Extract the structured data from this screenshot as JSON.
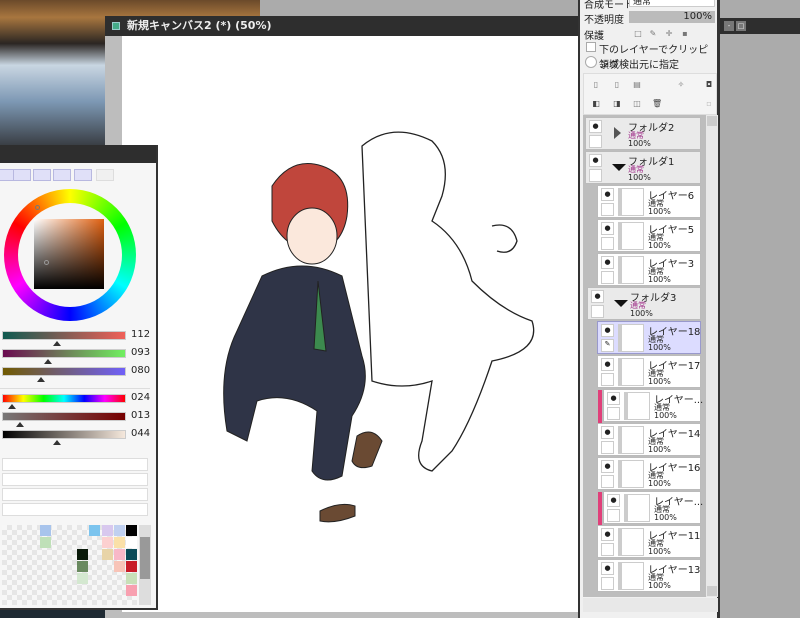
{
  "canvas": {
    "title": "新規キャンバス2 (*) (50%)"
  },
  "color_panel": {
    "sliders_rgb": [
      {
        "value": "112",
        "fraction": 0.44
      },
      {
        "value": "093",
        "fraction": 0.36
      },
      {
        "value": "080",
        "fraction": 0.31
      }
    ],
    "sliders_hsv": [
      {
        "value": "024",
        "fraction": 0.07
      },
      {
        "value": "013",
        "fraction": 0.13
      },
      {
        "value": "044",
        "fraction": 0.44
      }
    ],
    "swatch_colors": [
      "#a8c4ec",
      "#7cc4ee",
      "#d8c8ee",
      "#c0d0f0",
      "#000000",
      "#bfe0b8",
      "#fcd0d0",
      "#fae0a8",
      "#ffffff",
      "#0a1a0a",
      "#e8d4a8",
      "#f8b8c8",
      "#0a4a58",
      "#6a8a60",
      "#f8c4b8",
      "#c81c28",
      "#d4e8d0",
      "#c8e0b8",
      "#f8a0b0"
    ]
  },
  "layer_panel": {
    "blend_mode_label": "合成モード",
    "blend_mode_value": "通常",
    "opacity_label": "不透明度",
    "opacity_value": "100%",
    "protect_label": "保護",
    "clip_label": "下のレイヤーでクリッピング",
    "selection_source_label": "領域検出元に指定",
    "layers": [
      {
        "name": "フォルダ2",
        "mode": "通常",
        "opacity": "100%",
        "type": "folder",
        "expanded": false
      },
      {
        "name": "フォルダ1",
        "mode": "通常",
        "opacity": "100%",
        "type": "folder",
        "expanded": true
      },
      {
        "name": "レイヤー6",
        "mode": "通常",
        "opacity": "100%",
        "type": "layer"
      },
      {
        "name": "レイヤー5",
        "mode": "通常",
        "opacity": "100%",
        "type": "layer"
      },
      {
        "name": "レイヤー3",
        "mode": "通常",
        "opacity": "100%",
        "type": "layer"
      },
      {
        "name": "フォルダ3",
        "mode": "通常",
        "opacity": "100%",
        "type": "folder",
        "expanded": true
      },
      {
        "name": "レイヤー18",
        "mode": "通常",
        "opacity": "100%",
        "type": "layer",
        "selected": true
      },
      {
        "name": "レイヤー17",
        "mode": "通常",
        "opacity": "100%",
        "type": "layer"
      },
      {
        "name": "レイヤー...",
        "mode": "通常",
        "opacity": "100%",
        "type": "layer",
        "clipped": true
      },
      {
        "name": "レイヤー14",
        "mode": "通常",
        "opacity": "100%",
        "type": "layer"
      },
      {
        "name": "レイヤー16",
        "mode": "通常",
        "opacity": "100%",
        "type": "layer"
      },
      {
        "name": "レイヤー...",
        "mode": "通常",
        "opacity": "100%",
        "type": "layer",
        "clipped": true
      },
      {
        "name": "レイヤー11",
        "mode": "通常",
        "opacity": "100%",
        "type": "layer"
      },
      {
        "name": "レイヤー13",
        "mode": "通常",
        "opacity": "100%",
        "type": "layer"
      }
    ]
  },
  "colors": {
    "selected_layer": "#dcdcff",
    "clip_marker": "#e0407a",
    "folder_mode": "#a0308a"
  }
}
